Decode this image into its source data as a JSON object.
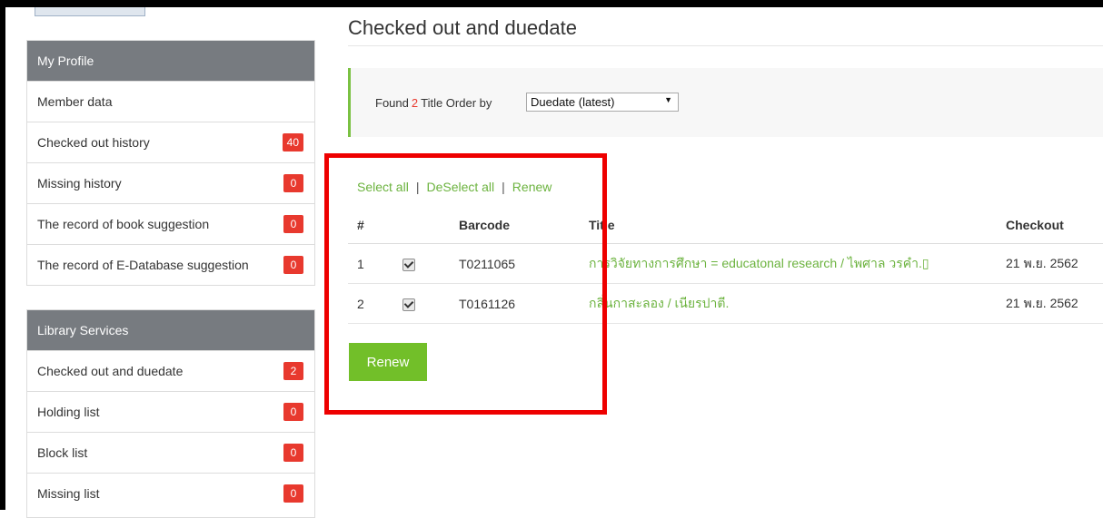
{
  "sidebar": {
    "profile": {
      "header": "My Profile",
      "items": [
        {
          "label": "Member data",
          "badge": null
        },
        {
          "label": "Checked out history",
          "badge": "40"
        },
        {
          "label": "Missing history",
          "badge": "0"
        },
        {
          "label": "The record of book suggestion",
          "badge": "0"
        },
        {
          "label": "The record of E-Database suggestion",
          "badge": "0"
        }
      ]
    },
    "services": {
      "header": "Library Services",
      "items": [
        {
          "label": "Checked out and duedate",
          "badge": "2"
        },
        {
          "label": "Holding list",
          "badge": "0"
        },
        {
          "label": "Block list",
          "badge": "0"
        },
        {
          "label": "Missing list",
          "badge": "0"
        }
      ]
    }
  },
  "main": {
    "title": "Checked out and duedate",
    "found_label": "Found",
    "found_count": "2",
    "found_suffix": "Title Order by",
    "sort_value": "Duedate (latest)",
    "actions": {
      "select_all": "Select all",
      "deselect_all": "DeSelect all",
      "renew": "Renew",
      "separator": "|"
    },
    "table": {
      "headers": {
        "num": "#",
        "barcode": "Barcode",
        "title": "Title",
        "checkout": "Checkout"
      },
      "rows": [
        {
          "num": "1",
          "checked": true,
          "barcode": "T0211065",
          "title": "การวิจัยทางการศึกษา = educatonal research / ไพศาล วรคำ.▯",
          "checkout": "21 พ.ย. 2562"
        },
        {
          "num": "2",
          "checked": true,
          "barcode": "T0161126",
          "title": "กลิ่นกาสะลอง / เนียรปาตี.",
          "checkout": "21 พ.ย. 2562"
        }
      ]
    },
    "renew_button": "Renew"
  },
  "colors": {
    "accent_green": "#72bf29",
    "badge_red": "#e8392e",
    "highlight_red": "#ee0000",
    "panel_header": "#777b80"
  }
}
